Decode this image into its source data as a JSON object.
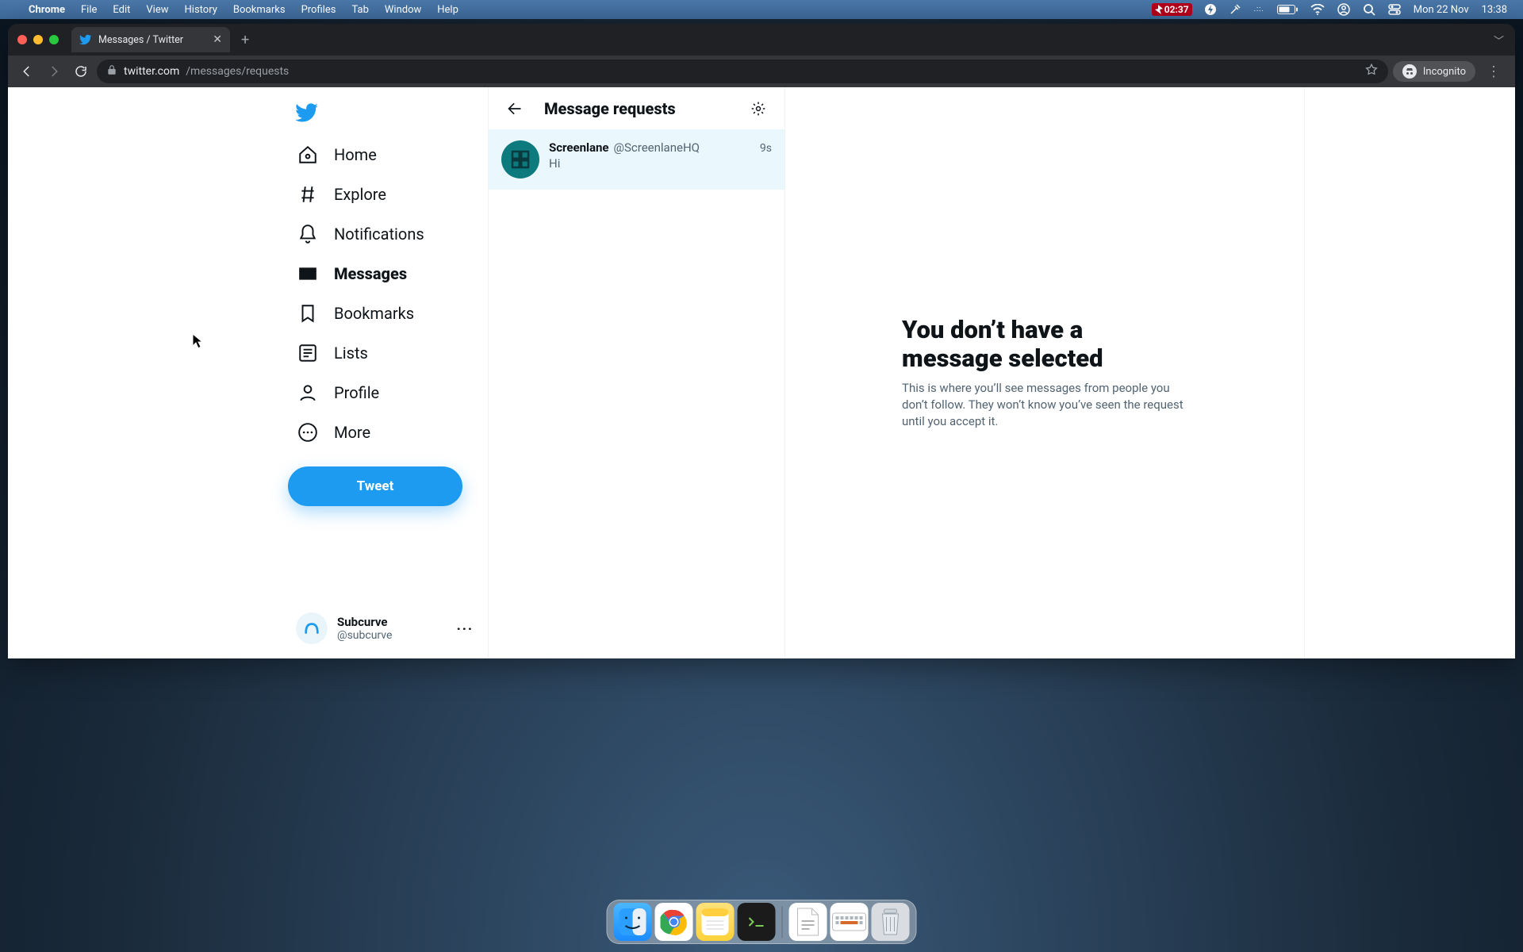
{
  "mac": {
    "app": "Chrome",
    "menus": [
      "File",
      "Edit",
      "View",
      "History",
      "Bookmarks",
      "Profiles",
      "Tab",
      "Window",
      "Help"
    ],
    "timer": "02:37",
    "date": "Mon 22 Nov",
    "time": "13:38"
  },
  "browser": {
    "tab_title": "Messages / Twitter",
    "url_host": "twitter.com",
    "url_path": "/messages/requests",
    "incognito_label": "Incognito"
  },
  "sidebar": {
    "items": [
      {
        "key": "home",
        "label": "Home"
      },
      {
        "key": "explore",
        "label": "Explore"
      },
      {
        "key": "notifications",
        "label": "Notifications"
      },
      {
        "key": "messages",
        "label": "Messages"
      },
      {
        "key": "bookmarks",
        "label": "Bookmarks"
      },
      {
        "key": "lists",
        "label": "Lists"
      },
      {
        "key": "profile",
        "label": "Profile"
      },
      {
        "key": "more",
        "label": "More"
      }
    ],
    "active_key": "messages",
    "tweet_button": "Tweet",
    "account": {
      "name": "Subcurve",
      "handle": "@subcurve"
    }
  },
  "mid": {
    "title": "Message requests",
    "requests": [
      {
        "name": "Screenlane",
        "handle": "@ScreenlaneHQ",
        "time": "9s",
        "preview": "Hi"
      }
    ]
  },
  "right": {
    "title": "You don’t have a message selected",
    "body": "This is where you’ll see messages from people you don’t follow. They won’t know you’ve seen the request until you accept it."
  },
  "colors": {
    "accent": "#1d9bf0",
    "text": "#0f1419",
    "muted": "#536471",
    "selected_bg": "#eaf7fd",
    "divider": "#eff3f4"
  }
}
